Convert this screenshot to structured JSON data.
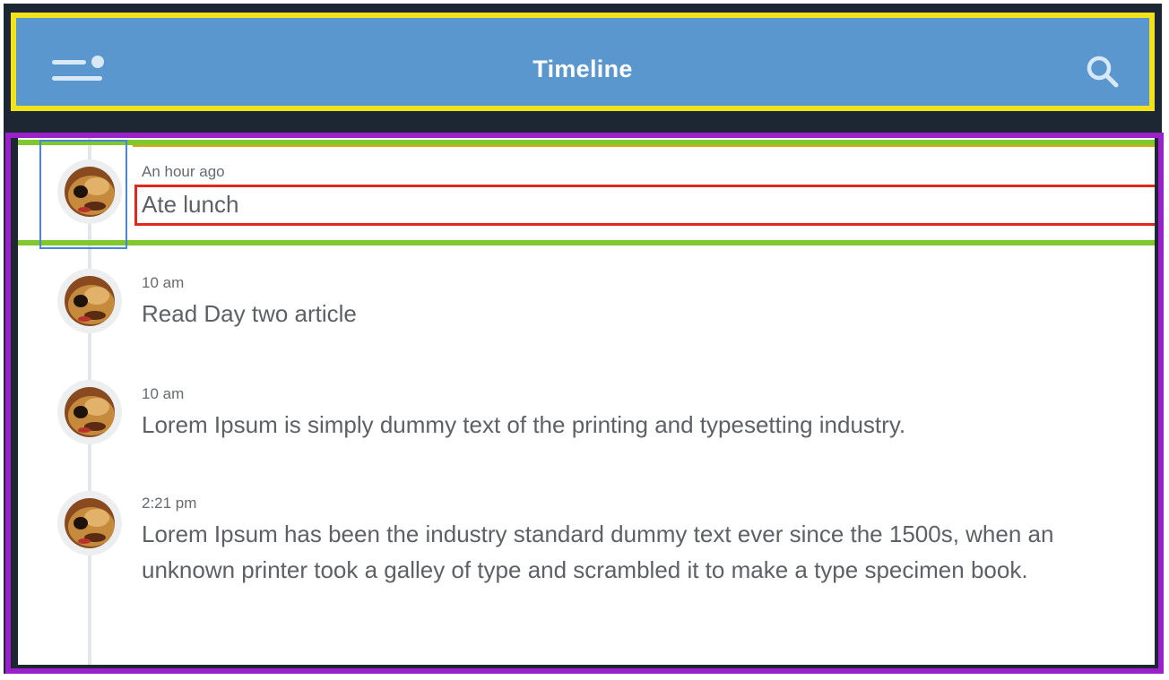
{
  "header": {
    "title": "Timeline",
    "menu_icon": "menu-icon",
    "search_icon": "search-icon"
  },
  "timeline": {
    "items": [
      {
        "time": "An hour ago",
        "text": "Ate lunch"
      },
      {
        "time": "10 am",
        "text": "Read Day two article"
      },
      {
        "time": "10 am",
        "text": "Lorem Ipsum is simply dummy text of the printing and typesetting industry."
      },
      {
        "time": "2:21 pm",
        "text": "Lorem Ipsum has been the industry standard dummy text ever since the 1500s, when an unknown printer took a galley of type and scrambled it to make a type specimen book."
      }
    ]
  },
  "colors": {
    "header_bg": "#5b97cf",
    "frame_bg": "#1d2733",
    "highlight_yellow": "#f1e21b",
    "highlight_purple": "#9a20c9",
    "highlight_green": "#7fc82e",
    "highlight_blue": "#4a86d8",
    "highlight_red": "#e0281b"
  }
}
